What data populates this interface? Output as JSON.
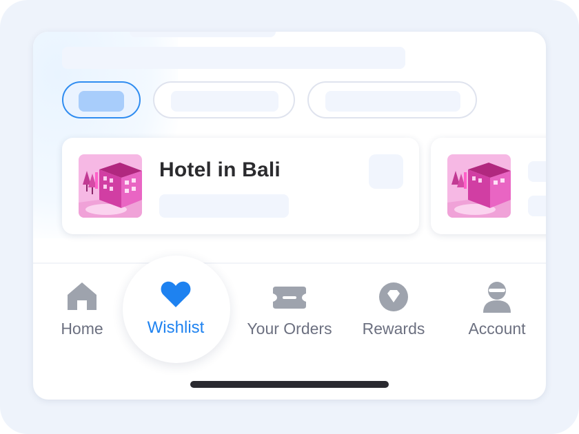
{
  "card": {
    "title": "Hotel in Bali"
  },
  "nav": {
    "items": [
      {
        "label": "Home",
        "icon": "home-icon",
        "active": false
      },
      {
        "label": "Wishlist",
        "icon": "heart-icon",
        "active": true
      },
      {
        "label": "Your Orders",
        "icon": "ticket-icon",
        "active": false
      },
      {
        "label": "Rewards",
        "icon": "diamond-icon",
        "active": false
      },
      {
        "label": "Account",
        "icon": "user-icon",
        "active": false
      }
    ]
  },
  "colors": {
    "accent": "#1e82f0",
    "inactive": "#6c7080",
    "icon_gray": "#9ea3ad",
    "hotel_pink": "#e94fb5"
  }
}
